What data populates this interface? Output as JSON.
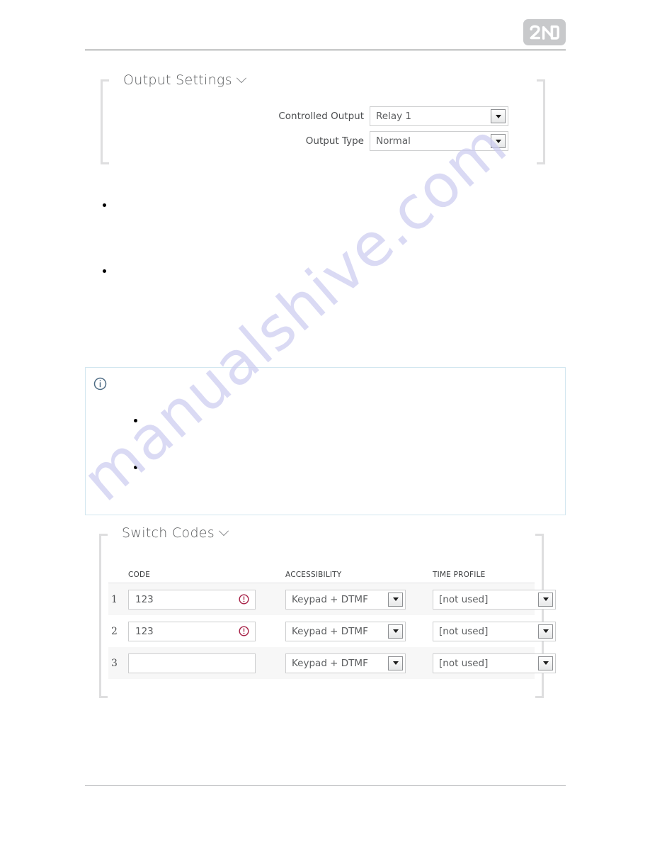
{
  "page": {
    "brand_logo_text": "2N",
    "watermark_text": "manualshive.com",
    "watermark_color": "#ccccf0",
    "header_rule_color": "#57585a",
    "footer_rule_color": "#c2c3c5",
    "panel_bracket_color": "#dededf"
  },
  "output_settings": {
    "title": "Output Settings",
    "chevron": "chevron-down",
    "fields": [
      {
        "label": "Controlled Output",
        "value": "Relay 1",
        "control": "select"
      },
      {
        "label": "Output Type",
        "value": "Normal",
        "control": "select"
      }
    ]
  },
  "body_bullets": [
    {
      "text": ""
    },
    {
      "text": ""
    }
  ],
  "note_box": {
    "icon": "info-circle-icon",
    "icon_color": "#4d6b84",
    "border_color": "#d3e7f0",
    "bullets": [
      {
        "text": ""
      },
      {
        "text": ""
      }
    ]
  },
  "switch_codes": {
    "title": "Switch Codes",
    "chevron": "chevron-down",
    "columns": [
      "CODE",
      "ACCESSIBILITY",
      "TIME PROFILE"
    ],
    "warning_icon": "warning-exclamation-icon",
    "warning_color": "#a61f45",
    "rows": [
      {
        "index": "1",
        "code": "123",
        "code_warning": true,
        "accessibility": "Keypad + DTMF",
        "time_profile": "[not used]"
      },
      {
        "index": "2",
        "code": "123",
        "code_warning": true,
        "accessibility": "Keypad + DTMF",
        "time_profile": "[not used]"
      },
      {
        "index": "3",
        "code": "",
        "code_warning": false,
        "accessibility": "Keypad + DTMF",
        "time_profile": "[not used]"
      }
    ]
  }
}
